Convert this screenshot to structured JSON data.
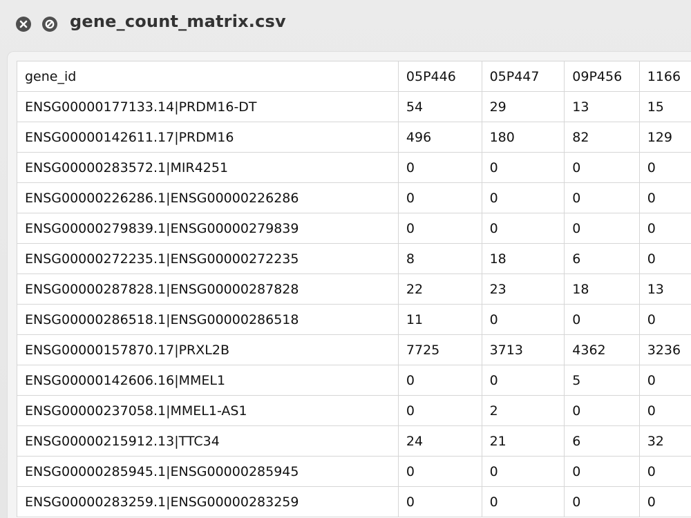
{
  "window": {
    "title": "gene_count_matrix.csv",
    "close_icon": "close-x-icon",
    "block_icon": "prohibited-icon"
  },
  "table": {
    "headers": [
      "gene_id",
      "05P446",
      "05P447",
      "09P456",
      "1166"
    ],
    "rows": [
      [
        "ENSG00000177133.14|PRDM16-DT",
        "54",
        "29",
        "13",
        "15"
      ],
      [
        "ENSG00000142611.17|PRDM16",
        "496",
        "180",
        "82",
        "129"
      ],
      [
        "ENSG00000283572.1|MIR4251",
        "0",
        "0",
        "0",
        "0"
      ],
      [
        "ENSG00000226286.1|ENSG00000226286",
        "0",
        "0",
        "0",
        "0"
      ],
      [
        "ENSG00000279839.1|ENSG00000279839",
        "0",
        "0",
        "0",
        "0"
      ],
      [
        "ENSG00000272235.1|ENSG00000272235",
        "8",
        "18",
        "6",
        "0"
      ],
      [
        "ENSG00000287828.1|ENSG00000287828",
        "22",
        "23",
        "18",
        "13"
      ],
      [
        "ENSG00000286518.1|ENSG00000286518",
        "11",
        "0",
        "0",
        "0"
      ],
      [
        "ENSG00000157870.17|PRXL2B",
        "7725",
        "3713",
        "4362",
        "3236"
      ],
      [
        "ENSG00000142606.16|MMEL1",
        "0",
        "0",
        "5",
        "0"
      ],
      [
        "ENSG00000237058.1|MMEL1-AS1",
        "0",
        "2",
        "0",
        "0"
      ],
      [
        "ENSG00000215912.13|TTC34",
        "24",
        "21",
        "6",
        "32"
      ],
      [
        "ENSG00000285945.1|ENSG00000285945",
        "0",
        "0",
        "0",
        "0"
      ],
      [
        "ENSG00000283259.1|ENSG00000283259",
        "0",
        "0",
        "0",
        "0"
      ]
    ]
  }
}
